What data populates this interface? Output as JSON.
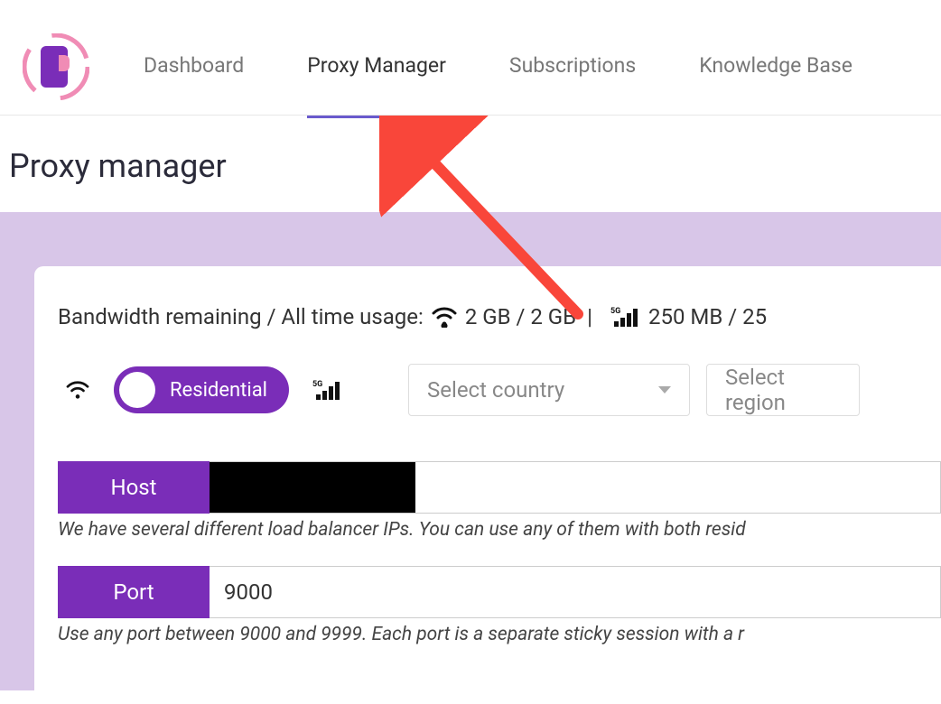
{
  "nav": {
    "items": [
      {
        "label": "Dashboard",
        "active": false
      },
      {
        "label": "Proxy Manager",
        "active": true
      },
      {
        "label": "Subscriptions",
        "active": false
      },
      {
        "label": "Knowledge Base",
        "active": false
      }
    ]
  },
  "page": {
    "title": "Proxy manager"
  },
  "bandwidth": {
    "label": "Bandwidth remaining / All time usage:",
    "wifi_value": "2 GB / 2 GB",
    "separator": "|",
    "mobile_value": "250 MB / 25"
  },
  "controls": {
    "toggle_label": "Residential",
    "country_placeholder": "Select country",
    "region_placeholder": "Select region"
  },
  "fields": {
    "host": {
      "label": "Host",
      "help": "We have several different load balancer IPs. You can use any of them with both resid"
    },
    "port": {
      "label": "Port",
      "value": "9000",
      "help": "Use any port between 9000 and 9999. Each port is a separate sticky session with a r"
    }
  },
  "colors": {
    "accent": "#7a2db8",
    "panel": "#d8c6e8",
    "annotation": "#f9463a"
  }
}
